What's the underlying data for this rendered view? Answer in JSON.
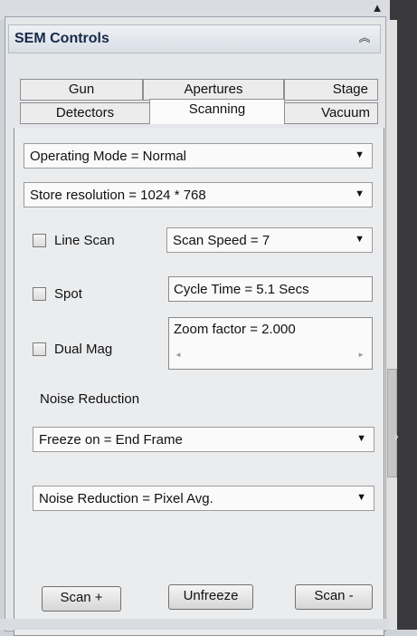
{
  "panel": {
    "title": "SEM Controls"
  },
  "tabs": {
    "row1": [
      "Gun",
      "Apertures",
      "Stage"
    ],
    "row2": [
      "Detectors",
      "Scanning",
      "Vacuum"
    ],
    "active": "Scanning"
  },
  "scanning": {
    "operating_mode": "Operating Mode = Normal",
    "store_resolution": "Store resolution = 1024 * 768",
    "line_scan": {
      "label": "Line Scan",
      "checked": false
    },
    "scan_speed": "Scan Speed = 7",
    "spot": {
      "label": "Spot",
      "checked": false
    },
    "cycle_time": "Cycle Time = 5.1  Secs",
    "dual_mag": {
      "label": "Dual Mag",
      "checked": false
    },
    "zoom_factor": "Zoom factor =  2.000",
    "noise_reduction_heading": "Noise Reduction",
    "freeze_on": "Freeze on = End Frame",
    "noise_reduction": "Noise Reduction = Pixel Avg."
  },
  "buttons": {
    "scan_plus": "Scan +",
    "unfreeze": "Unfreeze",
    "scan_minus": "Scan -"
  },
  "icons": {
    "collapse": "double-chevron-up-icon",
    "dropdown": "triangle-down-icon",
    "scroll_up": "caret-up-icon",
    "expand_side": "chevron-right-icon"
  }
}
